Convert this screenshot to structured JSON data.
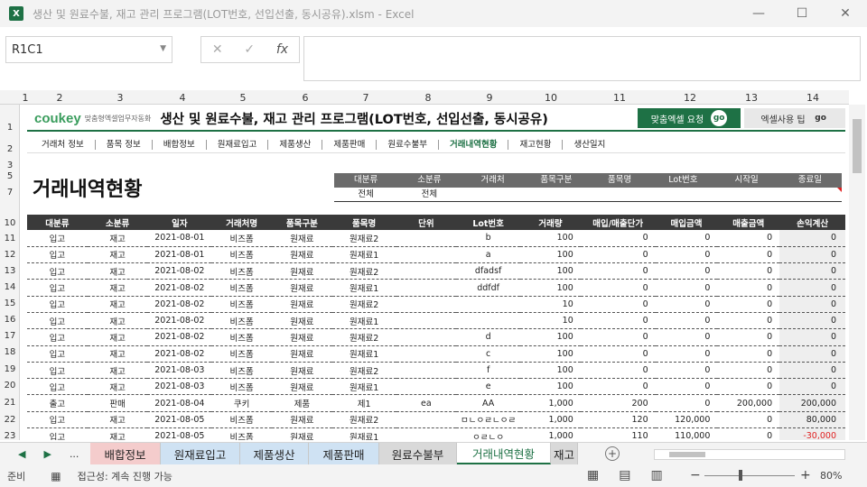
{
  "window": {
    "title": "생산 및 원료수불, 재고 관리 프로그램(LOT번호, 선입선출, 동시공유).xlsm  -  Excel",
    "minimize": "—",
    "restore": "☐",
    "close": "✕"
  },
  "formula_bar": {
    "name_box": "R1C1",
    "cancel": "✕",
    "enter": "✓",
    "fx": "fx",
    "value": ""
  },
  "column_headers": [
    "1",
    "2",
    "3",
    "4",
    "5",
    "6",
    "7",
    "8",
    "9",
    "10",
    "11",
    "12",
    "13",
    "14"
  ],
  "row_headers": [
    "1",
    "2",
    "3",
    "5",
    "7",
    "10",
    "11",
    "12",
    "13",
    "14",
    "15",
    "16",
    "17",
    "18",
    "19",
    "20",
    "21",
    "22",
    "23"
  ],
  "brand": {
    "logo": "coukey",
    "tagline": "맞춤형엑셀업무자동화",
    "program_title": "생산 및 원료수불, 재고 관리 프로그램(LOT번호, 선입선출, 동시공유)",
    "request_button": "맞춤엑셀 요청",
    "tips_button": "엑셀사용 팁",
    "go": "go"
  },
  "nav": [
    "거래처 정보",
    "품목 정보",
    "배합정보",
    "원재료입고",
    "제품생산",
    "제품판매",
    "원료수불부",
    "거래내역현황",
    "재고현황",
    "생산일지"
  ],
  "nav_active": "거래내역현황",
  "page_title": "거래내역현황",
  "filter": {
    "headers": [
      "대분류",
      "소분류",
      "거래처",
      "품목구분",
      "품목명",
      "Lot번호",
      "시작일",
      "종료일"
    ],
    "values": [
      "전체",
      "전체",
      "",
      "",
      "",
      "",
      "",
      ""
    ]
  },
  "table": {
    "headers": [
      "대분류",
      "소분류",
      "일자",
      "거래처명",
      "품목구분",
      "품목명",
      "단위",
      "Lot번호",
      "거래량",
      "매입/매출단가",
      "매입금액",
      "매출금액",
      "손익계산"
    ],
    "rows": [
      [
        "입고",
        "재고",
        "2021-08-01",
        "비즈폼",
        "원재료",
        "원재료2",
        "",
        "b",
        "100",
        "0",
        "0",
        "0",
        "0"
      ],
      [
        "입고",
        "재고",
        "2021-08-01",
        "비즈폼",
        "원재료",
        "원재료1",
        "",
        "a",
        "100",
        "0",
        "0",
        "0",
        "0"
      ],
      [
        "입고",
        "재고",
        "2021-08-02",
        "비즈폼",
        "원재료",
        "원재료2",
        "",
        "dfadsf",
        "100",
        "0",
        "0",
        "0",
        "0"
      ],
      [
        "입고",
        "재고",
        "2021-08-02",
        "비즈폼",
        "원재료",
        "원재료1",
        "",
        "ddfdf",
        "100",
        "0",
        "0",
        "0",
        "0"
      ],
      [
        "입고",
        "재고",
        "2021-08-02",
        "비즈폼",
        "원재료",
        "원재료2",
        "",
        "",
        "10",
        "0",
        "0",
        "0",
        "0"
      ],
      [
        "입고",
        "재고",
        "2021-08-02",
        "비즈폼",
        "원재료",
        "원재료1",
        "",
        "",
        "10",
        "0",
        "0",
        "0",
        "0"
      ],
      [
        "입고",
        "재고",
        "2021-08-02",
        "비즈폼",
        "원재료",
        "원재료2",
        "",
        "d",
        "100",
        "0",
        "0",
        "0",
        "0"
      ],
      [
        "입고",
        "재고",
        "2021-08-02",
        "비즈폼",
        "원재료",
        "원재료1",
        "",
        "c",
        "100",
        "0",
        "0",
        "0",
        "0"
      ],
      [
        "입고",
        "재고",
        "2021-08-03",
        "비즈폼",
        "원재료",
        "원재료2",
        "",
        "f",
        "100",
        "0",
        "0",
        "0",
        "0"
      ],
      [
        "입고",
        "재고",
        "2021-08-03",
        "비즈폼",
        "원재료",
        "원재료1",
        "",
        "e",
        "100",
        "0",
        "0",
        "0",
        "0"
      ],
      [
        "출고",
        "판매",
        "2021-08-04",
        "쿠키",
        "제품",
        "제1",
        "ea",
        "AA",
        "1,000",
        "200",
        "0",
        "200,000",
        "200,000"
      ],
      [
        "입고",
        "재고",
        "2021-08-05",
        "비즈폼",
        "원재료",
        "원재료2",
        "",
        "ㅁㄴㅇㄹㄴㅇㄹ",
        "1,000",
        "120",
        "120,000",
        "0",
        "80,000"
      ],
      [
        "입고",
        "재고",
        "2021-08-05",
        "비즈폼",
        "원재료",
        "원재료1",
        "",
        "ㅇㄹㄴㅇ",
        "1,000",
        "110",
        "110,000",
        "0",
        "-30,000"
      ]
    ]
  },
  "sheet_tabs": [
    "배합정보",
    "원재료입고",
    "제품생산",
    "제품판매",
    "원료수불부",
    "거래내역현황",
    "재고"
  ],
  "sheet_tab_active": "거래내역현황",
  "sheet_tab_colors": [
    "#f4cccc",
    "#cfe2f3",
    "#cfe2f3",
    "#cfe2f3",
    "#d9d9d9",
    "#ffffff",
    "#d9d9d9"
  ],
  "tab_nav": {
    "prev": "◀",
    "next": "▶",
    "more": "...",
    "add": "+"
  },
  "status": {
    "ready": "준비",
    "accessibility": "접근성: 계속 진행 가능",
    "zoom": "80%"
  },
  "colors": {
    "accent": "#1e7145",
    "header_dark": "#3a3a3a",
    "filter_header": "#6b6b6b",
    "negative": "#e02020"
  }
}
